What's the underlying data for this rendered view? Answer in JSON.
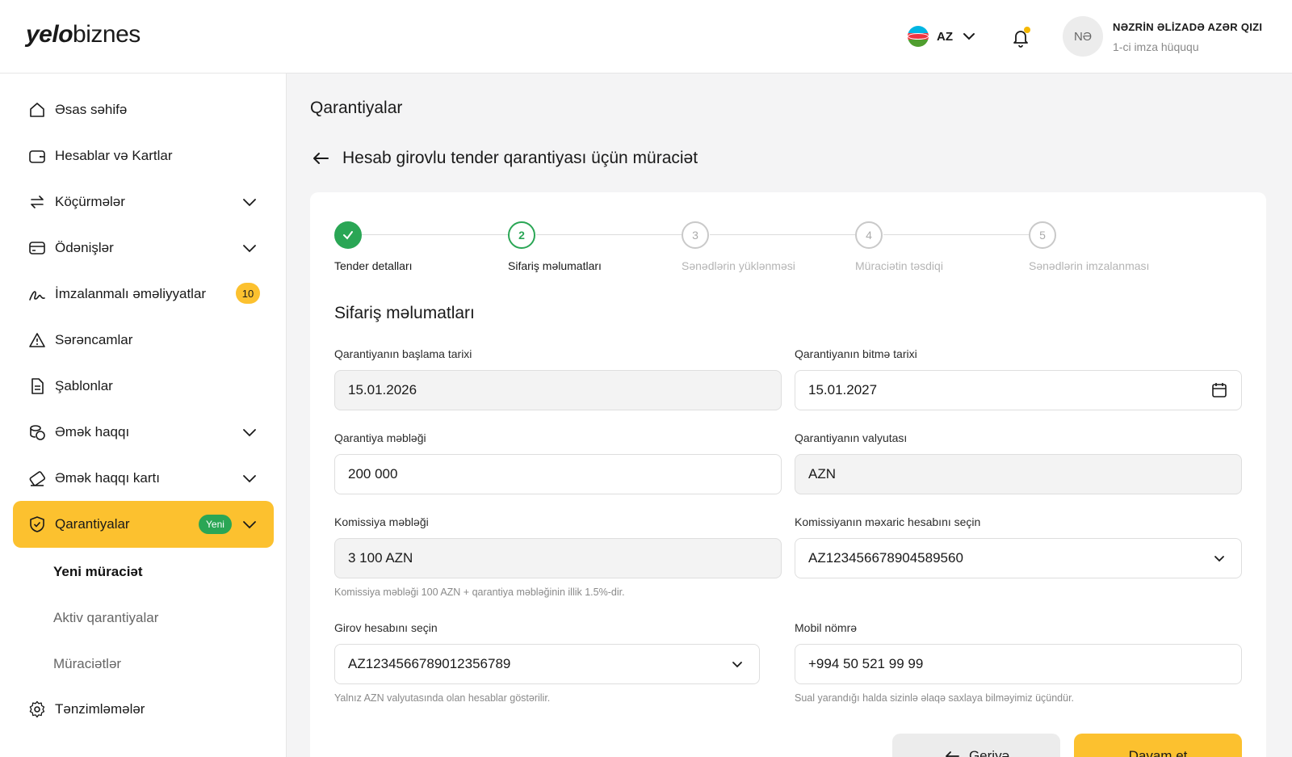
{
  "header": {
    "logo_bold": "yelo",
    "logo_light": "biznes",
    "language": "AZ",
    "user_initials": "NƏ",
    "user_name": "NƏZRİN ƏLİZADƏ AZƏR QIZI",
    "user_role": "1-ci imza hüququ",
    "accent_color": "#fcc12f",
    "notification_dot_color": "#f5b800"
  },
  "sidebar": {
    "items": [
      {
        "label": "Əsas səhifə",
        "icon": "home-icon"
      },
      {
        "label": "Hesablar və Kartlar",
        "icon": "wallet-icon"
      },
      {
        "label": "Köçürmələr",
        "icon": "transfer-icon"
      },
      {
        "label": "Ödənişlər",
        "icon": "card-icon"
      },
      {
        "label": "İmzalanmalı əməliyyatlar",
        "icon": "signature-icon",
        "badge": "10"
      },
      {
        "label": "Sərəncamlar",
        "icon": "warning-icon"
      },
      {
        "label": "Şablonlar",
        "icon": "document-icon"
      },
      {
        "label": "Əmək haqqı",
        "icon": "coins-icon"
      },
      {
        "label": "Əmək haqqı kartı",
        "icon": "pay-card-icon"
      },
      {
        "label": "Qarantiyalar",
        "icon": "shield-icon",
        "badge": "Yeni",
        "active": true
      },
      {
        "label": "Tənzimləmələr",
        "icon": "gear-icon"
      }
    ],
    "sub_items": [
      "Yeni müraciət",
      "Aktiv qarantiyalar",
      "Müraciətlər"
    ]
  },
  "main": {
    "page_title": "Qarantiyalar",
    "form_title": "Hesab girovlu tender qarantiyası üçün müraciət",
    "steps": [
      {
        "num": "1",
        "label": "Tender detalları",
        "state": "done"
      },
      {
        "num": "2",
        "label": "Sifariş məlumatları",
        "state": "current"
      },
      {
        "num": "3",
        "label": "Sənədlərin yüklənməsi",
        "state": "pending"
      },
      {
        "num": "4",
        "label": "Müraciətin təsdiqi",
        "state": "pending"
      },
      {
        "num": "5",
        "label": "Sənədlərin imzalanması",
        "state": "pending"
      }
    ],
    "section_title": "Sifariş məlumatları",
    "fields": {
      "start_date": {
        "label": "Qarantiyanın başlama tarixi",
        "value": "15.01.2026"
      },
      "end_date": {
        "label": "Qarantiyanın bitmə tarixi",
        "value": "15.01.2027"
      },
      "amount": {
        "label": "Qarantiya məbləği",
        "value": "200 000"
      },
      "currency": {
        "label": "Qarantiyanın valyutası",
        "value": "AZN"
      },
      "commission": {
        "label": "Komissiya məbləği",
        "value": "3 100 AZN",
        "hint": "Komissiya məbləği 100 AZN + qarantiya məbləğinin illik 1.5%-dir."
      },
      "commission_account": {
        "label": "Komissiyanın məxaric hesabını seçin",
        "value": "AZ123456678904589560"
      },
      "pledge_account": {
        "label": "Girov hesabını seçin",
        "value": "AZ123456678901235​6789",
        "hint": "Yalnız AZN valyutasında olan hesablar göstərilir."
      },
      "mobile": {
        "label": "Mobil nömrə",
        "value": "+994 50 521 99 99",
        "hint": "Sual yarandığı halda sizinlə əlaqə saxlaya bilməyimiz üçündür."
      }
    },
    "buttons": {
      "back": "Geriyə",
      "next": "Davam et"
    }
  }
}
